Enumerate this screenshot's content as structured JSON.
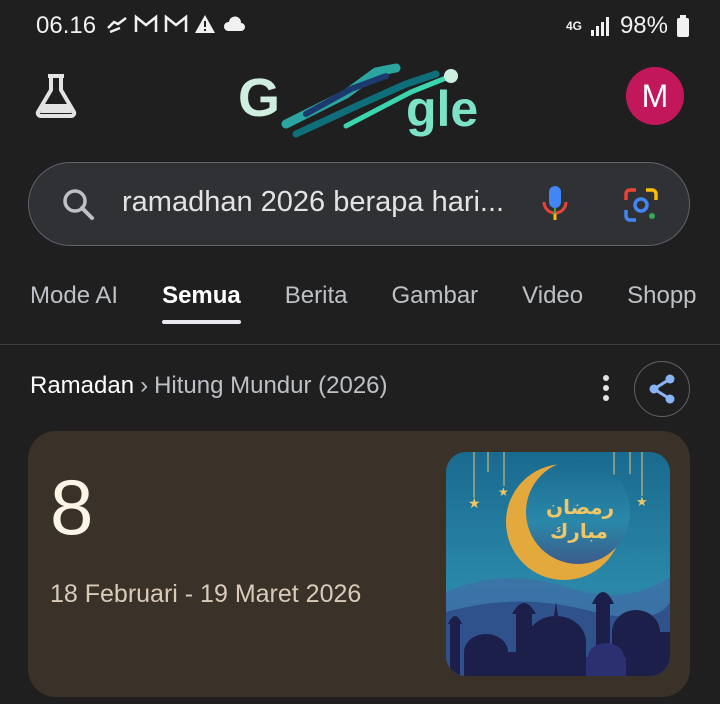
{
  "status_bar": {
    "time": "06.16",
    "network": "4G",
    "battery": "98%"
  },
  "header": {
    "avatar_letter": "M"
  },
  "search": {
    "query": "ramadhan 2026 berapa hari..."
  },
  "tabs": [
    {
      "label": "Mode AI"
    },
    {
      "label": "Semua"
    },
    {
      "label": "Berita"
    },
    {
      "label": "Gambar"
    },
    {
      "label": "Video"
    },
    {
      "label": "Shopp"
    }
  ],
  "breadcrumb": {
    "main": "Ramadan",
    "separator": "›",
    "sub": "Hitung Mundur (2026)"
  },
  "card": {
    "days_count": "8",
    "date_range": "18 Februari - 19 Maret 2026"
  },
  "colors": {
    "background": "#1f1f1f",
    "avatar": "#c2185b",
    "card": "#3a3128"
  }
}
